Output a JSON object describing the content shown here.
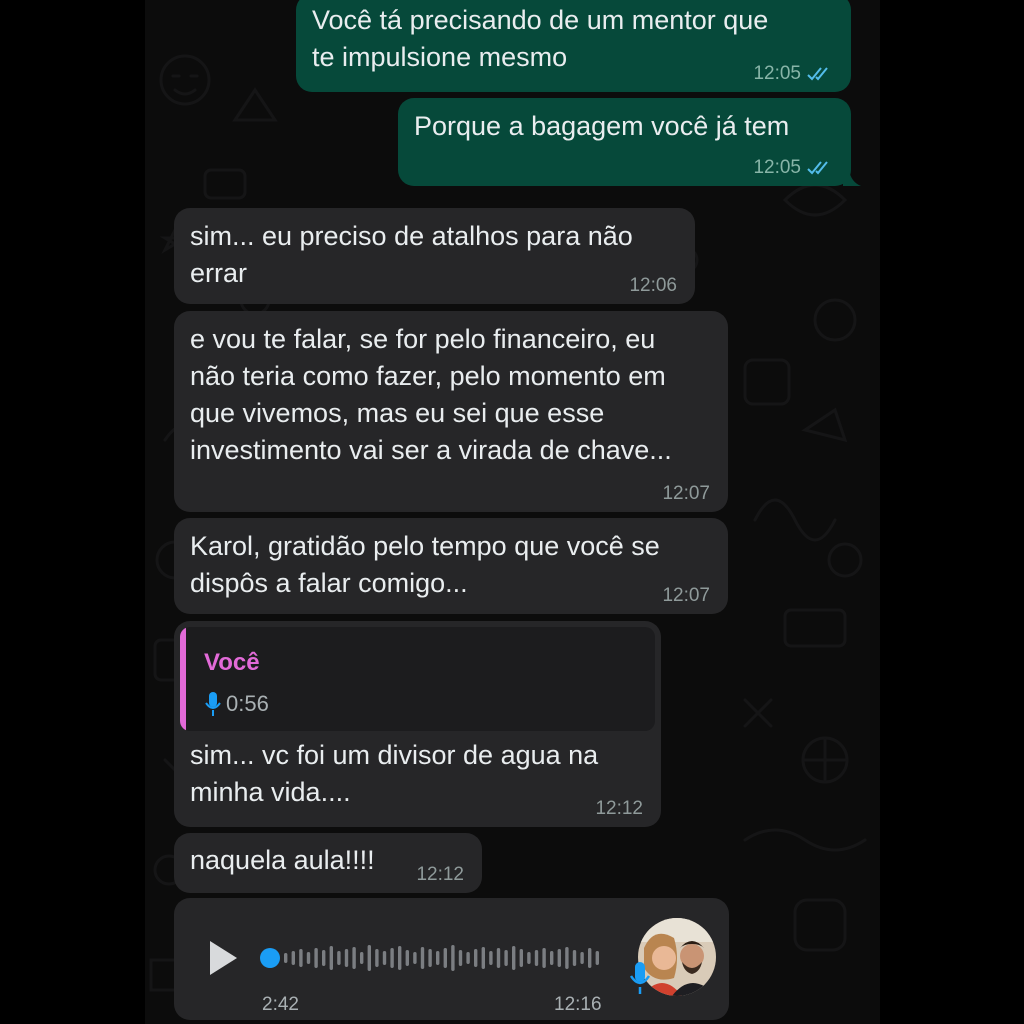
{
  "messages": [
    {
      "id": "m1",
      "direction": "outgoing",
      "text": "Você tá precisando de um mentor que\nte impulsione mesmo",
      "time": "12:05",
      "status": "read"
    },
    {
      "id": "m2",
      "direction": "outgoing",
      "text": "Porque a bagagem você já tem",
      "time": "12:05",
      "status": "read"
    },
    {
      "id": "m3",
      "direction": "incoming",
      "text": "sim... eu preciso de atalhos para não\nerrar",
      "time": "12:06"
    },
    {
      "id": "m4",
      "direction": "incoming",
      "text": "e vou te falar, se for pelo financeiro, eu\nnão teria como fazer, pelo momento em\nque vivemos, mas eu sei que esse\ninvestimento vai ser a virada de chave...",
      "time": "12:07"
    },
    {
      "id": "m5",
      "direction": "incoming",
      "text": "Karol, gratidão pelo tempo que você se\ndispôs a falar comigo...",
      "time": "12:07"
    },
    {
      "id": "m6",
      "direction": "incoming",
      "quote": {
        "author": "Você",
        "type": "voice",
        "duration": "0:56"
      },
      "text": "sim... vc foi um divisor de agua na\nminha vida....",
      "time": "12:12"
    },
    {
      "id": "m7",
      "direction": "incoming",
      "text": "naquela aula!!!!",
      "time": "12:12"
    },
    {
      "id": "m8",
      "direction": "incoming",
      "type": "voice",
      "duration": "2:42",
      "time": "12:16",
      "progress": 0
    }
  ],
  "icons": {
    "read_ticks": "double-check-icon",
    "mic": "microphone-icon",
    "play": "play-icon"
  },
  "colors": {
    "outgoing_bubble": "#06493a",
    "incoming_bubble": "#262628",
    "read_ticks": "#53bdeb",
    "quote_author": "#e26ad8",
    "mic": "#1a9df5"
  }
}
